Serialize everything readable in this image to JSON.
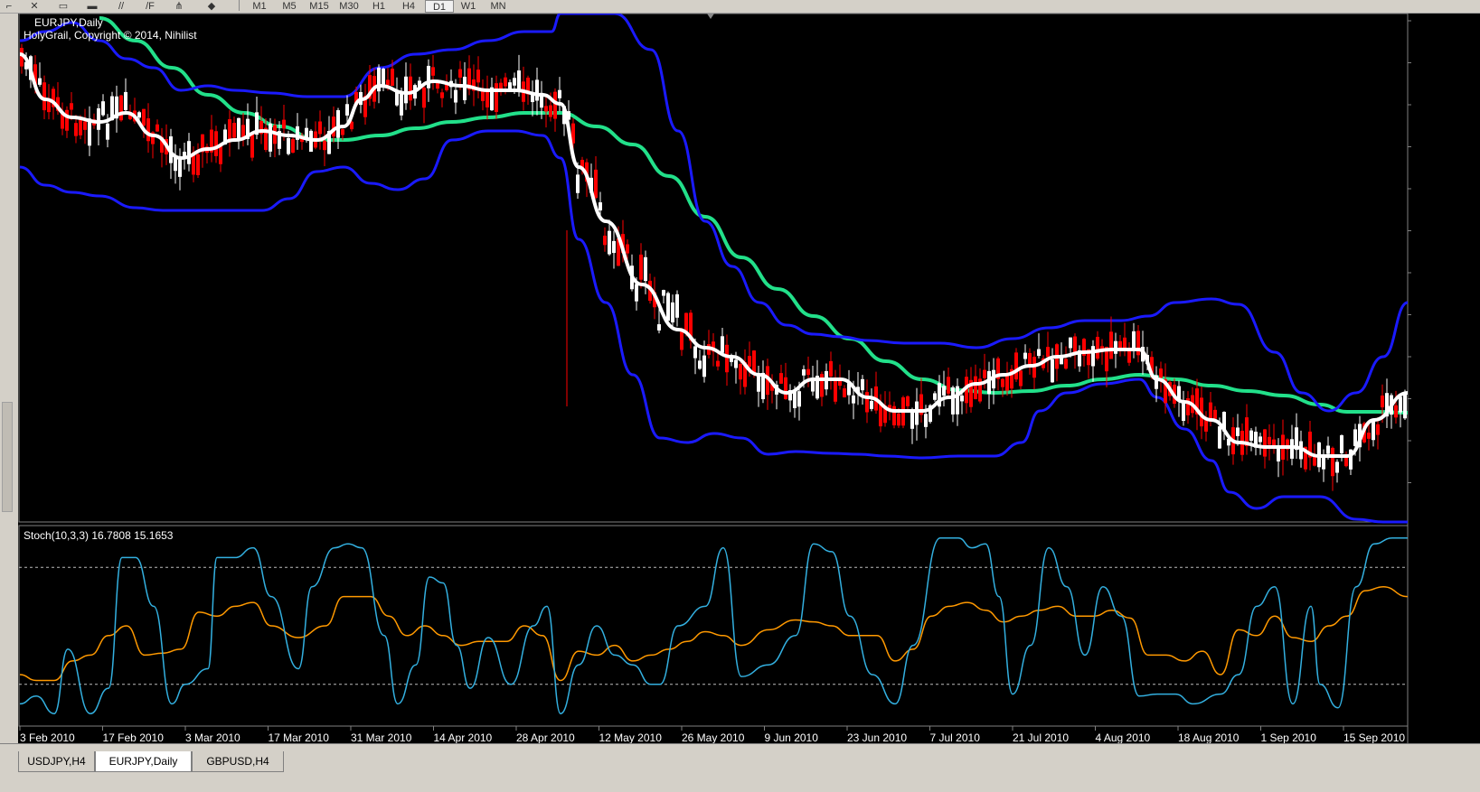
{
  "toolbar": {
    "timeframes": [
      "M1",
      "M5",
      "M15",
      "M30",
      "H1",
      "H4",
      "D1",
      "W1",
      "MN"
    ],
    "active_timeframe": "D1"
  },
  "chart": {
    "symbol_label": "EURJPY,Daily",
    "indicator_label": "HolyGrail, Copyright © 2014, Nihilist",
    "date_labels": [
      "3 Feb 2010",
      "17 Feb 2010",
      "3 Mar 2010",
      "17 Mar 2010",
      "31 Mar 2010",
      "14 Apr 2010",
      "28 Apr 2010",
      "12 May 2010",
      "26 May 2010",
      "9 Jun 2010",
      "23 Jun 2010",
      "7 Jul 2010",
      "21 Jul 2010",
      "4 Aug 2010",
      "18 Aug 2010",
      "1 Sep 2010",
      "15 Sep 2010"
    ]
  },
  "stoch": {
    "label": "Stoch(10,3,3) 16.7808 15.1653",
    "levels": [
      "100",
      "80",
      "20",
      "0"
    ]
  },
  "tabs": {
    "items": [
      "USDJPY,H4",
      "EURJPY,Daily",
      "GBPUSD,H4"
    ],
    "active": "EURJPY,Daily"
  },
  "colors": {
    "background": "#000000",
    "bull_candle": "#ffffff",
    "bear_candle": "#ff0000",
    "bands": "#1a1aff",
    "middle_ma": "#ffffff",
    "slow_ma": "#22e08a",
    "stoch_main": "#33b0e0",
    "stoch_signal": "#ff9900"
  },
  "chart_data": {
    "type": "candlestick",
    "title": "EURJPY,Daily",
    "x_range": [
      "2010-02-01",
      "2010-09-20"
    ],
    "x_ticks": [
      "3 Feb 2010",
      "17 Feb 2010",
      "3 Mar 2010",
      "17 Mar 2010",
      "31 Mar 2010",
      "14 Apr 2010",
      "28 Apr 2010",
      "12 May 2010",
      "26 May 2010",
      "9 Jun 2010",
      "23 Jun 2010",
      "7 Jul 2010",
      "21 Jul 2010",
      "4 Aug 2010",
      "18 Aug 2010",
      "1 Sep 2010",
      "15 Sep 2010"
    ],
    "series": [
      {
        "name": "middle_ma",
        "values": [
          127,
          124,
          122,
          123,
          123,
          122,
          124,
          128,
          129,
          127,
          126,
          126,
          118,
          114,
          113,
          112,
          114,
          116,
          118,
          116,
          117,
          115,
          115,
          110,
          112,
          112,
          115
        ]
      },
      {
        "name": "slow_ma",
        "values": [
          130,
          129,
          127,
          125,
          124,
          123,
          122,
          122,
          122,
          122,
          121,
          121,
          119,
          118,
          116,
          115,
          114,
          113,
          113,
          113,
          113,
          114,
          114,
          115,
          114,
          114,
          113
        ]
      }
    ],
    "stochastic": {
      "label": "Stoch(10,3,3) 16.7808 15.1653",
      "levels": [
        100,
        80,
        20,
        0
      ],
      "main_last": 16.7808,
      "signal_last": 15.1653
    },
    "grid": false
  }
}
